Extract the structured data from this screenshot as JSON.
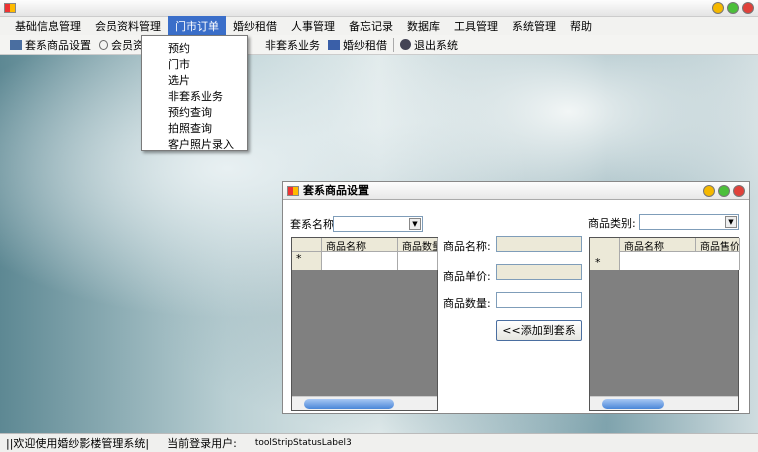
{
  "menu": [
    "基础信息管理",
    "会员资料管理",
    "门市订单",
    "婚纱租借",
    "人事管理",
    "备忘记录",
    "数据库",
    "工具管理",
    "系统管理",
    "帮助"
  ],
  "toolbar": [
    "套系商品设置",
    "会员资料管理",
    "非套系业务",
    "婚纱租借",
    "退出系统"
  ],
  "dropdown": [
    "预约",
    "门市",
    "选片",
    "非套系业务",
    "预约查询",
    "拍照查询",
    "客户照片录入"
  ],
  "dialog": {
    "title": "套系商品设置",
    "package_label": "套系名称:",
    "category_label": "商品类别:",
    "left_cols": [
      "商品名称",
      "商品数量"
    ],
    "right_cols": [
      "商品名称",
      "商品售价"
    ],
    "new_row_marker": "*",
    "name_label": "商品名称:",
    "price_label": "商品单价:",
    "qty_label": "商品数量:",
    "add_button": "<<添加到套系"
  },
  "status": [
    "||欢迎使用婚纱影楼管理系统|",
    "当前登录用户:",
    "toolStripStatusLabel3"
  ]
}
